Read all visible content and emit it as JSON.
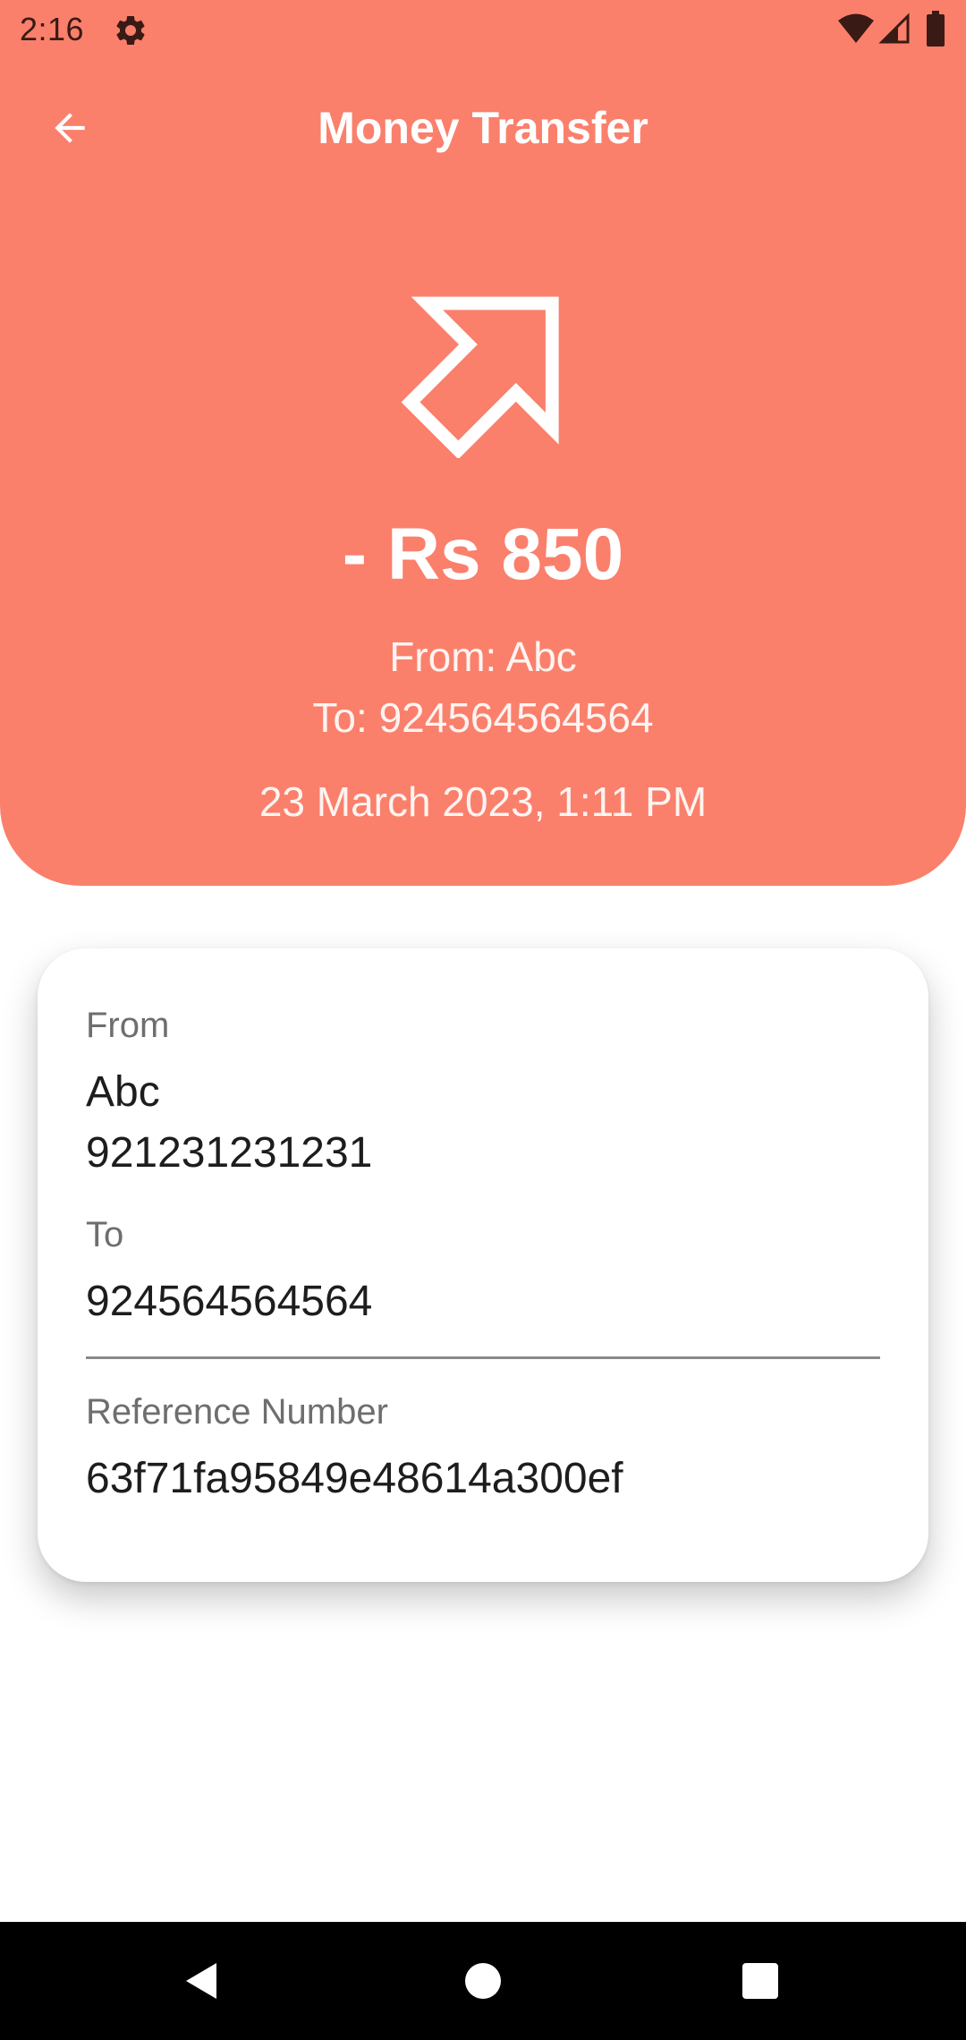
{
  "status_bar": {
    "time": "2:16",
    "icons": [
      "gear-icon",
      "wifi-icon",
      "signal-icon",
      "battery-icon"
    ]
  },
  "app_bar": {
    "title": "Money Transfer",
    "back_icon": "arrow-left-icon"
  },
  "summary": {
    "icon": "arrow-up-right-icon",
    "amount": "- Rs 850",
    "from_line": "From: Abc",
    "to_line": "To: 924564564564",
    "datetime": "23 March 2023, 1:11 PM"
  },
  "details": {
    "from_label": "From",
    "from_name": "Abc",
    "from_number": "921231231231",
    "to_label": "To",
    "to_number": "924564564564",
    "reference_label": "Reference Number",
    "reference_value": "63f71fa95849e48614a300ef"
  },
  "nav_bar": {
    "icons": [
      "back-triangle-icon",
      "home-circle-icon",
      "recents-square-icon"
    ]
  },
  "colors": {
    "header": "#FA806C",
    "text_on_header": "#FFFFFF",
    "card_background": "#FFFFFF",
    "label_text": "#6E6E6E",
    "value_text": "#1D1D1D",
    "nav_bar": "#000000"
  }
}
